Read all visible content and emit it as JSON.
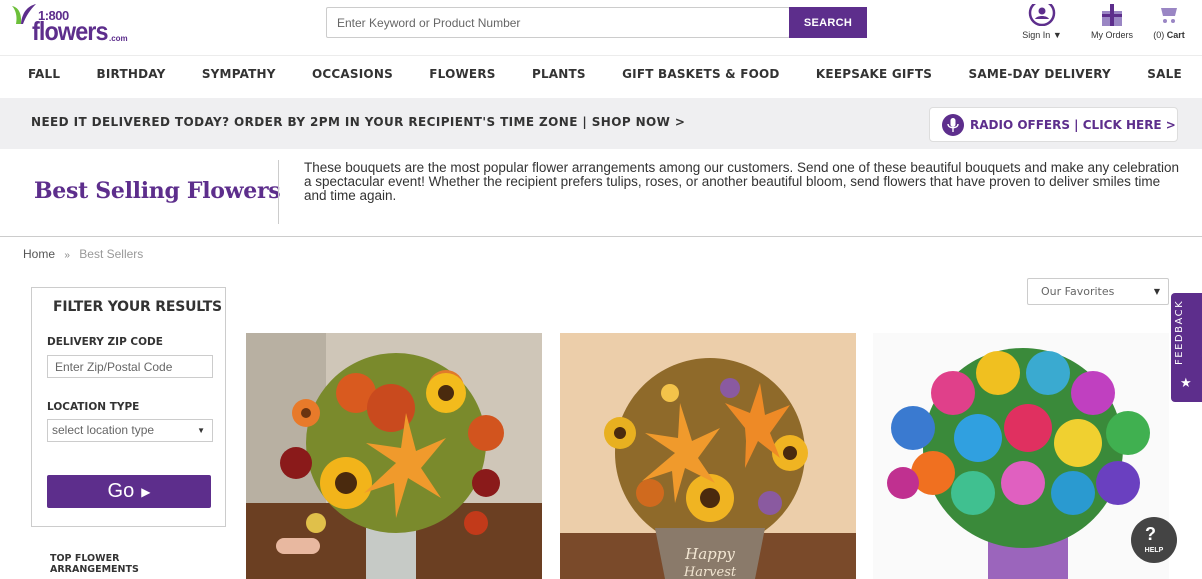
{
  "header": {
    "logo": {
      "number": "1:800",
      "word": "flowers",
      "suffix": ".com"
    },
    "search": {
      "placeholder": "Enter Keyword or Product Number",
      "button_label": "SEARCH"
    },
    "utility": {
      "sign_in": "Sign In",
      "my_orders": "My Orders",
      "cart_count": "(0)",
      "cart_label": "Cart"
    }
  },
  "nav": {
    "items": [
      "FALL",
      "BIRTHDAY",
      "SYMPATHY",
      "OCCASIONS",
      "FLOWERS",
      "PLANTS",
      "GIFT BASKETS & FOOD",
      "KEEPSAKE GIFTS",
      "SAME-DAY DELIVERY",
      "SALE"
    ]
  },
  "promo": {
    "text": "NEED IT DELIVERED TODAY? ORDER BY 2PM IN YOUR RECIPIENT'S TIME ZONE | SHOP NOW >",
    "radio_label": "RADIO OFFERS | CLICK HERE >"
  },
  "page": {
    "title": "Best Selling Flowers",
    "intro": "These bouquets are the most popular flower arrangements among our customers. Send one of these beautiful bouquets and make any celebration a spectacular event! Whether the recipient prefers tulips, roses, or another beautiful bloom, send flowers that have proven to deliver smiles time and time again."
  },
  "breadcrumb": {
    "home": "Home",
    "separator": "»",
    "current": "Best Sellers"
  },
  "sort": {
    "selected": "Our Favorites"
  },
  "filter": {
    "title": "FILTER YOUR RESULTS",
    "zip_label": "DELIVERY ZIP CODE",
    "zip_placeholder": "Enter Zip/Postal Code",
    "location_label": "LOCATION TYPE",
    "location_selected": "select location type",
    "go_label": "Go"
  },
  "sidebar": {
    "top_arrangements": "TOP FLOWER ARRANGEMENTS"
  },
  "products": [
    {
      "image": "fall-lily-sunflower-bouquet"
    },
    {
      "image": "happy-harvest-bouquet",
      "embossed_text": "Happy Harvest"
    },
    {
      "image": "rainbow-roses"
    }
  ],
  "feedback": {
    "label": "FEEDBACK"
  },
  "help": {
    "label": "HELP"
  },
  "colors": {
    "brand_purple": "#5d2e8c",
    "promo_bg": "#efeff1"
  }
}
